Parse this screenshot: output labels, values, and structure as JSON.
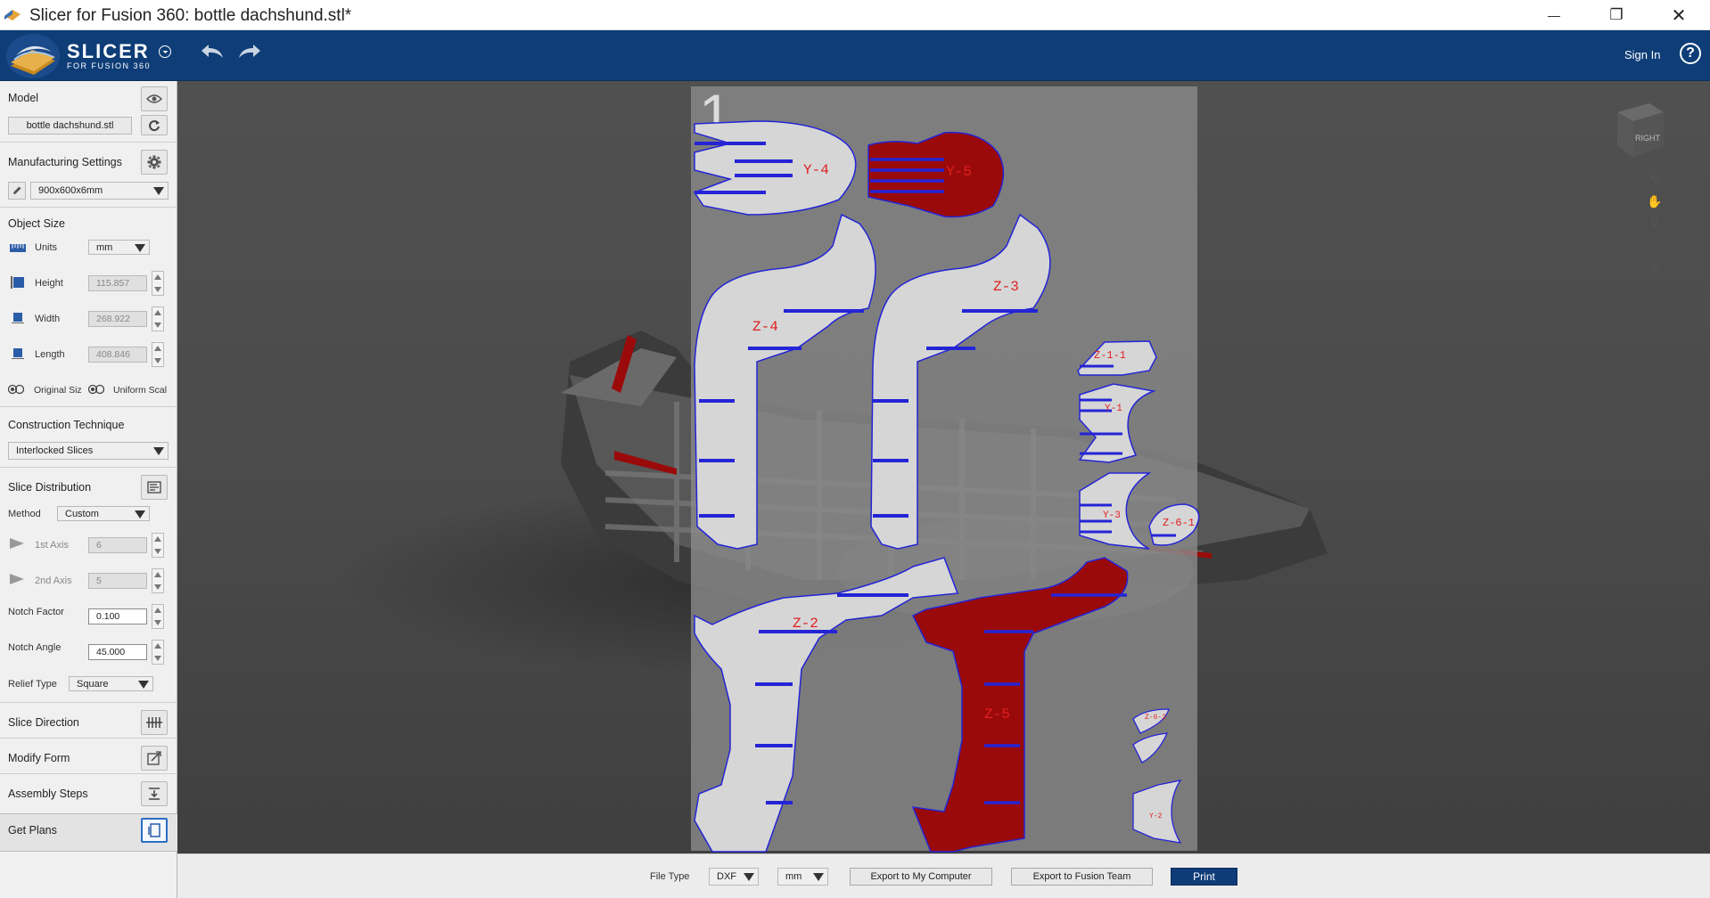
{
  "window": {
    "title": "Slicer for Fusion 360: bottle dachshund.stl*",
    "minimize_glyph": "—",
    "maximize_glyph": "❐",
    "close_glyph": "✕"
  },
  "header": {
    "brand_main": "SLICER",
    "brand_sub": "FOR FUSION 360",
    "sign_in": "Sign In",
    "help": "?"
  },
  "sidebar": {
    "model": {
      "title": "Model",
      "file_button": "bottle dachshund.stl",
      "icons": [
        "eye-icon",
        "refresh-icon"
      ]
    },
    "manufacturing": {
      "title": "Manufacturing Settings",
      "preset": "900x600x6mm",
      "icons": [
        "gear-icon",
        "pencil-icon"
      ]
    },
    "object_size": {
      "title": "Object Size",
      "units_label": "Units",
      "units_value": "mm",
      "height_label": "Height",
      "height_value": "115.857",
      "width_label": "Width",
      "width_value": "268.922",
      "length_label": "Length",
      "length_value": "408.846",
      "original_size": "Original Siz",
      "uniform_scale": "Uniform Scal"
    },
    "construction": {
      "title": "Construction Technique",
      "value": "Interlocked Slices"
    },
    "slice_distribution": {
      "title": "Slice Distribution",
      "method_label": "Method",
      "method_value": "Custom",
      "axis1_label": "1st Axis",
      "axis1_value": "6",
      "axis2_label": "2nd Axis",
      "axis2_value": "5",
      "notch_factor_label": "Notch Factor",
      "notch_factor_value": "0.100",
      "notch_angle_label": "Notch Angle",
      "notch_angle_value": "45.000",
      "relief_label": "Relief Type",
      "relief_value": "Square"
    },
    "slice_direction": "Slice Direction",
    "modify_form": "Modify Form",
    "assembly_steps": "Assembly Steps",
    "get_plans": "Get Plans"
  },
  "viewport": {
    "sheet_number": "1",
    "viewcube_label": "RIGHT",
    "parts": [
      {
        "label": "Y-4",
        "fill": "light"
      },
      {
        "label": "Y-5",
        "fill": "red"
      },
      {
        "label": "Z-4",
        "fill": "light"
      },
      {
        "label": "Z-3",
        "fill": "light"
      },
      {
        "label": "Z-1-1",
        "fill": "light"
      },
      {
        "label": "Y-1",
        "fill": "light"
      },
      {
        "label": "Y-3",
        "fill": "light"
      },
      {
        "label": "Z-6-1",
        "fill": "light"
      },
      {
        "label": "Z-2",
        "fill": "light"
      },
      {
        "label": "Z-5",
        "fill": "red"
      },
      {
        "label": "Z-6-2",
        "fill": "light"
      },
      {
        "label": "Y-2",
        "fill": "light"
      }
    ],
    "colors": {
      "part_light": "#d6d6d6",
      "part_red": "#9b0a0a",
      "outline": "#2424d6",
      "label": "#e02020"
    }
  },
  "bottombar": {
    "file_type_label": "File Type",
    "file_type_value": "DXF",
    "unit_value": "mm",
    "export_computer": "Export to My Computer",
    "export_fusion": "Export to Fusion Team",
    "print": "Print"
  }
}
